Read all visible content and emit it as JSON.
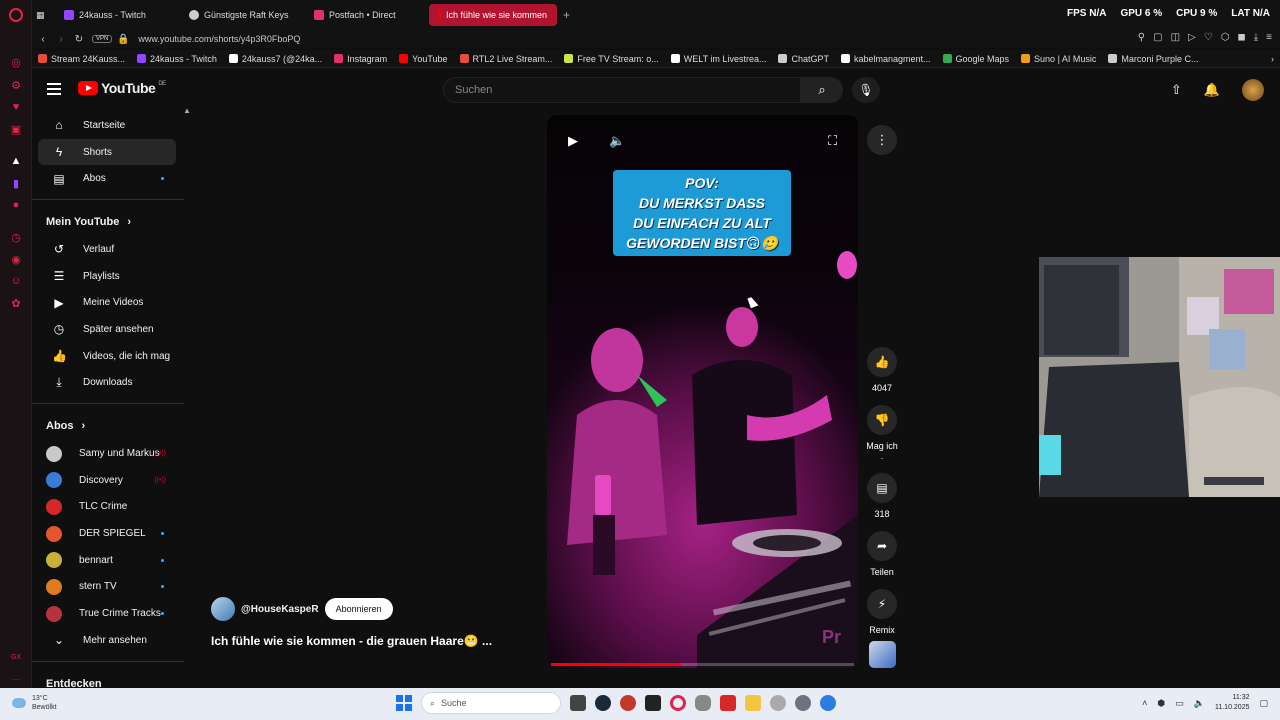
{
  "browser": {
    "tabs": [
      {
        "label": "24kauss - Twitch",
        "color": "#9146ff"
      },
      {
        "label": "Günstigste Raft Keys",
        "color": "#cccccc"
      },
      {
        "label": "Postfach • Direct",
        "color": "#e1306c"
      },
      {
        "label": "Ich fühle wie sie kommen",
        "color": "#ff0000"
      }
    ],
    "new_tab": "+",
    "hud": {
      "fps_label": "FPS",
      "fps": "N/A",
      "gpu_label": "GPU",
      "gpu": "6 %",
      "cpu_label": "CPU",
      "cpu": "9 %",
      "lat_label": "LAT",
      "lat": "N/A"
    },
    "vpn": "VPN",
    "url": "www.youtube.com/shorts/y4p3R0FboPQ",
    "bookmarks": [
      {
        "label": "Stream 24Kauss...",
        "color": "#e74c3c"
      },
      {
        "label": "24kauss - Twitch",
        "color": "#9146ff"
      },
      {
        "label": "24kauss7 (@24ka...",
        "color": "#ffffff"
      },
      {
        "label": "Instagram",
        "color": "#e1306c"
      },
      {
        "label": "YouTube",
        "color": "#ff0000"
      },
      {
        "label": "RTL2 Live Stream...",
        "color": "#e74c3c"
      },
      {
        "label": "Free TV Stream: o...",
        "color": "#c8e64a"
      },
      {
        "label": "WELT im Livestrea...",
        "color": "#ffffff"
      },
      {
        "label": "ChatGPT",
        "color": "#cccccc"
      },
      {
        "label": "kabelmanagment...",
        "color": "#ffffff"
      },
      {
        "label": "Google Maps",
        "color": "#34a853"
      },
      {
        "label": "Suno | AI Music",
        "color": "#f39c12"
      },
      {
        "label": "Marconi Purple C...",
        "color": "#cccccc"
      }
    ]
  },
  "youtube": {
    "logo_text": "YouTube",
    "region": "DE",
    "search_placeholder": "Suchen",
    "nav_main": [
      {
        "label": "Startseite",
        "icon": "home-icon"
      },
      {
        "label": "Shorts",
        "icon": "shorts-icon"
      },
      {
        "label": "Abos",
        "icon": "subscriptions-icon"
      }
    ],
    "you_section": "Mein YouTube",
    "nav_you": [
      {
        "label": "Verlauf",
        "icon": "history-icon"
      },
      {
        "label": "Playlists",
        "icon": "playlists-icon"
      },
      {
        "label": "Meine Videos",
        "icon": "my-videos-icon"
      },
      {
        "label": "Später ansehen",
        "icon": "watch-later-icon"
      },
      {
        "label": "Videos, die ich mag",
        "icon": "liked-icon"
      },
      {
        "label": "Downloads",
        "icon": "download-icon"
      }
    ],
    "subs_section": "Abos",
    "subscriptions": [
      {
        "label": "Samy und Markus",
        "color": "#c9c9c9",
        "state": "live"
      },
      {
        "label": "Discovery",
        "color": "#3a7bd5",
        "state": "live"
      },
      {
        "label": "TLC Crime",
        "color": "#d62828",
        "state": "none"
      },
      {
        "label": "DER SPIEGEL",
        "color": "#e4572e",
        "state": "dot"
      },
      {
        "label": "bennart",
        "color": "#c9b037",
        "state": "dot"
      },
      {
        "label": "stern TV",
        "color": "#e07a1f",
        "state": "dot"
      },
      {
        "label": "True Crime Tracks",
        "color": "#b8323c",
        "state": "dot"
      }
    ],
    "more": "Mehr ansehen",
    "explore_section": "Entdecken",
    "short": {
      "overlay_lines": [
        "POV:",
        "DU MERKST DASS",
        "DU EINFACH ZU ALT",
        "GEWORDEN BIST🙃🥲"
      ],
      "progress": 0.43,
      "channel": "@HouseKaspeR",
      "subscribe": "Abonnieren",
      "title": "Ich fühle wie sie kommen - die grauen Haare😬 ..."
    },
    "actions": [
      {
        "label": "4047",
        "icon": "like-icon"
      },
      {
        "label": "Mag ich .",
        "icon": "dislike-icon"
      },
      {
        "label": "318",
        "icon": "comments-icon"
      },
      {
        "label": "Teilen",
        "icon": "share-icon"
      },
      {
        "label": "Remix",
        "icon": "remix-icon"
      }
    ]
  },
  "taskbar": {
    "weather_temp": "13°C",
    "weather_text": "Bewölkt",
    "search": "Suche",
    "time": "11:32",
    "date": "11.10.2025"
  }
}
